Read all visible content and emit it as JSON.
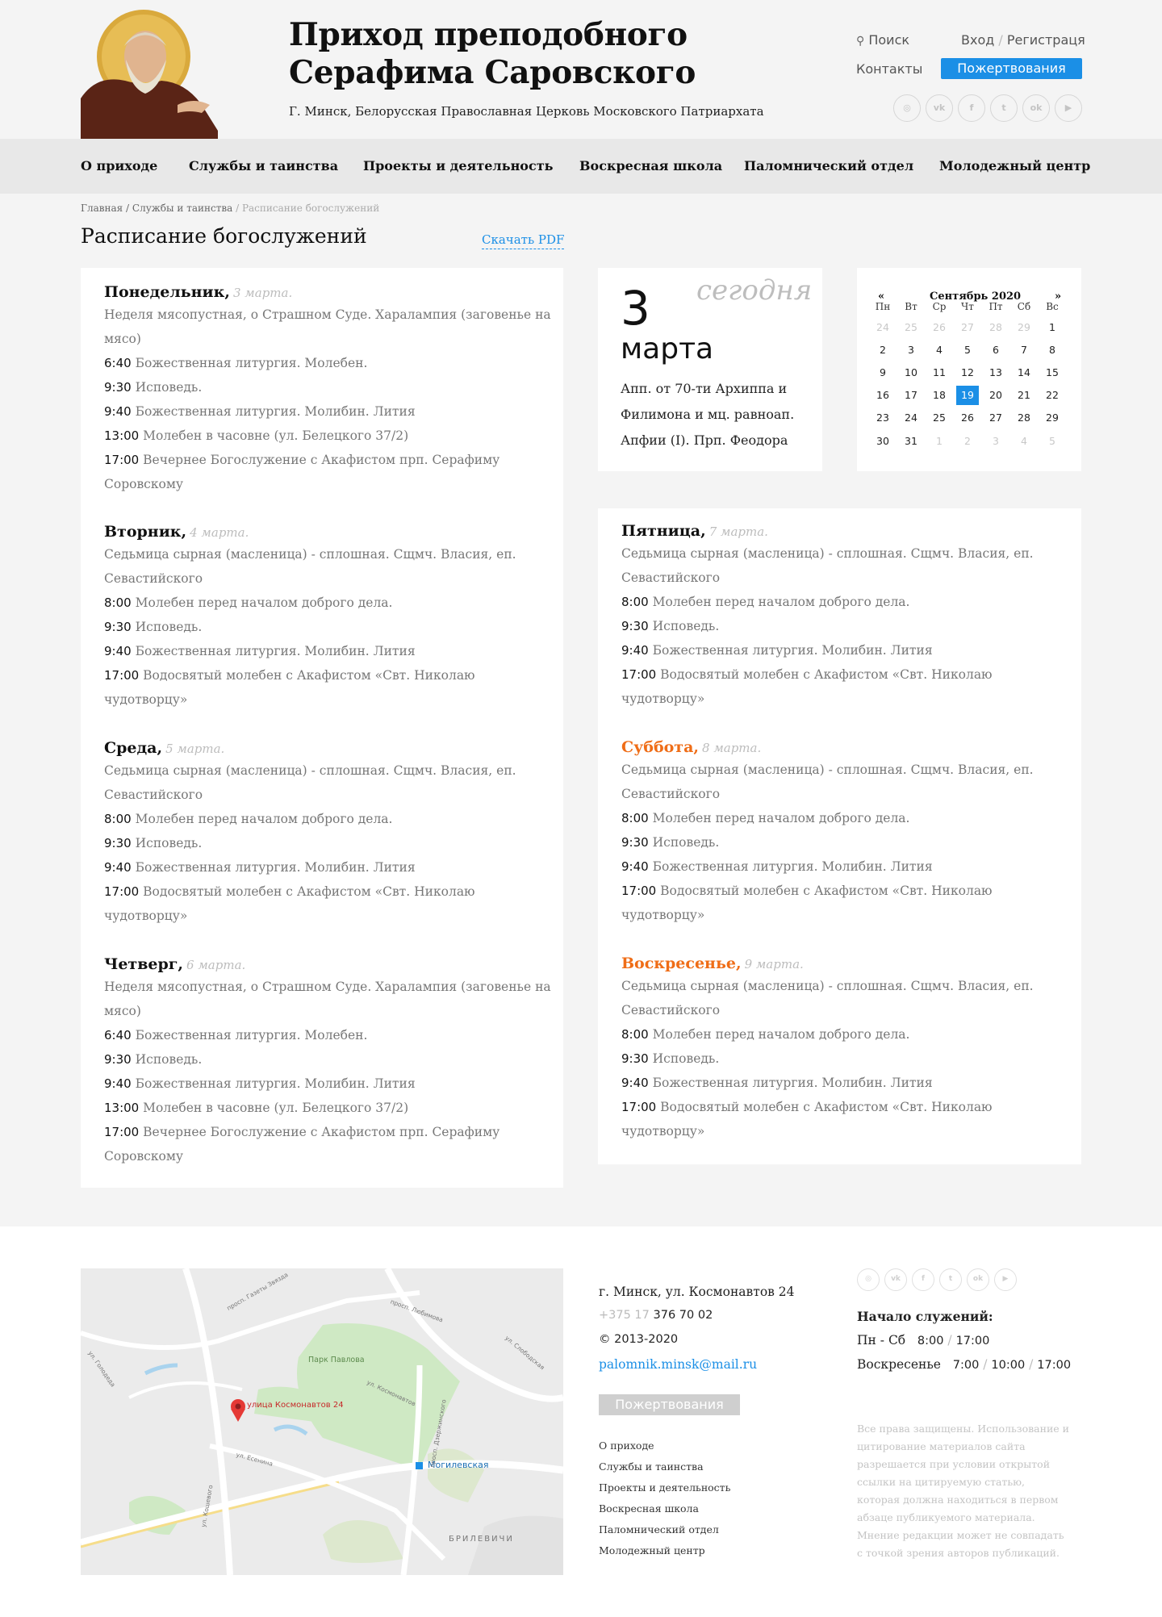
{
  "header": {
    "title_line1": "Приход преподобного",
    "title_line2": "Серафима Саровского",
    "subtitle": "Г. Минск, Белорусская Православная Церковь Московского Патриархата",
    "search": "Поиск",
    "login": "Вход",
    "register": "Регистраця",
    "contacts": "Контакты",
    "donate": "Пожертвования",
    "social": [
      "instagram-icon",
      "vk-icon",
      "facebook-icon",
      "twitter-icon",
      "odnoklassniki-icon",
      "youtube-icon"
    ]
  },
  "nav": [
    "О приходе",
    "Службы и таинства",
    "Проекты и деятельность",
    "Воскресная школа",
    "Паломнический отдел",
    "Молодежный центр"
  ],
  "breadcrumb": {
    "home": "Главная",
    "section": "Службы и таинства",
    "current": "Расписание богослужений"
  },
  "page": {
    "title": "Расписание богослужений",
    "pdf": "Скачать PDF"
  },
  "today": {
    "label": "сегодня",
    "day": "3",
    "month": "марта",
    "text": "Апп. от 70-ти Архиппа и Филимона и мц. равноап. Апфии (I). Прп. Феодора"
  },
  "calendar": {
    "prev": "«",
    "next": "»",
    "title": "Сентябрь 2020",
    "weekdays": [
      "Пн",
      "Вт",
      "Ср",
      "Чт",
      "Пт",
      "Сб",
      "Вс"
    ],
    "weeks": [
      [
        "24",
        "25",
        "26",
        "27",
        "28",
        "29",
        "1"
      ],
      [
        "2",
        "3",
        "4",
        "5",
        "6",
        "7",
        "8"
      ],
      [
        "9",
        "10",
        "11",
        "12",
        "13",
        "14",
        "15"
      ],
      [
        "16",
        "17",
        "18",
        "19",
        "20",
        "21",
        "22"
      ],
      [
        "23",
        "24",
        "25",
        "26",
        "27",
        "28",
        "29"
      ],
      [
        "30",
        "31",
        "1",
        "2",
        "3",
        "4",
        "5"
      ]
    ],
    "selected": "19"
  },
  "days_left": [
    {
      "name": "Понедельник,",
      "date": "3 марта.",
      "desc": "Неделя мясопустная, о Страшном Суде. Харалампия (заговенье на мясо)",
      "items": [
        [
          "6:40",
          "Божественная литургия. Молебен."
        ],
        [
          "9:30",
          "Исповедь."
        ],
        [
          "9:40",
          "Божественная литургия. Молибин. Лития"
        ],
        [
          "13:00",
          "Молебен в часовне (ул. Белецкого 37/2)"
        ],
        [
          "17:00",
          "Вечернее Богослужение с Акафистом прп. Серафиму Соровскому"
        ]
      ]
    },
    {
      "name": "Вторник,",
      "date": "4 марта.",
      "desc": "Седьмица сырная (масленица)  - сплошная. Сщмч. Власия, еп. Севастийского",
      "items": [
        [
          "8:00",
          "Молебен перед началом доброго дела."
        ],
        [
          "9:30",
          "Исповедь."
        ],
        [
          "9:40",
          "Божественная литургия. Молибин. Лития"
        ],
        [
          "17:00",
          "Водосвятый молебен с Акафистом «Свт. Николаю чудотворцу»"
        ]
      ]
    },
    {
      "name": "Среда,",
      "date": "5 марта.",
      "desc": "Седьмица сырная (масленица)  - сплошная. Сщмч. Власия, еп. Севастийского",
      "items": [
        [
          "8:00",
          "Молебен перед началом доброго дела."
        ],
        [
          "9:30",
          "Исповедь."
        ],
        [
          "9:40",
          "Божественная литургия. Молибин. Лития"
        ],
        [
          "17:00",
          "Водосвятый молебен с Акафистом «Свт. Николаю чудотворцу»"
        ]
      ]
    },
    {
      "name": "Четверг,",
      "date": "6 марта.",
      "desc": "Неделя мясопустная, о Страшном Суде. Харалампия (заговенье на мясо)",
      "items": [
        [
          "6:40",
          "Божественная литургия. Молебен."
        ],
        [
          "9:30",
          "Исповедь."
        ],
        [
          "9:40",
          "Божественная литургия. Молибин. Лития"
        ],
        [
          "13:00",
          "Молебен в часовне (ул. Белецкого 37/2)"
        ],
        [
          "17:00",
          "Вечернее Богослужение с Акафистом прп. Серафиму Соровскому"
        ]
      ]
    }
  ],
  "days_right": [
    {
      "name": "Пятница,",
      "date": "7 марта.",
      "desc": "Седьмица сырная (масленица)  - сплошная. Сщмч. Власия, еп. Севастийского",
      "items": [
        [
          "8:00",
          "Молебен перед началом доброго дела."
        ],
        [
          "9:30",
          "Исповедь."
        ],
        [
          "9:40",
          "Божественная литургия. Молибин. Лития"
        ],
        [
          "17:00",
          "Водосвятый молебен с Акафистом «Свт. Николаю чудотворцу»"
        ]
      ]
    },
    {
      "name": "Суббота,",
      "date": "8 марта.",
      "desc": "Седьмица сырная (масленица)  - сплошная. Сщмч. Власия, еп. Севастийского",
      "items": [
        [
          "8:00",
          "Молебен перед началом доброго дела."
        ],
        [
          "9:30",
          "Исповедь."
        ],
        [
          "9:40",
          "Божественная литургия. Молибин. Лития"
        ],
        [
          "17:00",
          "Водосвятый молебен с Акафистом «Свт. Николаю чудотворцу»"
        ]
      ]
    },
    {
      "name": "Воскресенье,",
      "date": "9 марта.",
      "desc": "Седьмица сырная (масленица)  - сплошная. Сщмч. Власия, еп. Севастийского",
      "items": [
        [
          "8:00",
          "Молебен перед началом доброго дела."
        ],
        [
          "9:30",
          "Исповедь."
        ],
        [
          "9:40",
          "Божественная литургия. Молибин. Лития"
        ],
        [
          "17:00",
          "Водосвятый молебен с Акафистом «Свт. Николаю чудотворцу»"
        ]
      ]
    }
  ],
  "footer": {
    "address": "г. Минск, ул. Космонавтов 24",
    "phone_prefix": "+375 17",
    "phone": "376 70 02",
    "copyright": "©  2013-2020",
    "email": "palomnik.minsk@mail.ru",
    "donate": "Пожертвования",
    "links": [
      "О приходе",
      "Службы и таинства",
      "Проекты и деятельность",
      "Воскресная школа",
      "Паломнический отдел",
      "Молодежный центр"
    ],
    "services_title": "Начало служений:",
    "weekdays_label": "Пн - Сб",
    "weekdays_times": [
      "8:00",
      "17:00"
    ],
    "sunday_label": "Воскресенье",
    "sunday_times": [
      "7:00",
      "10:00",
      "17:00"
    ],
    "note": "Все права защищены. Использование и цитирование материалов сайта разрешается при условии открытой ссылки на цитируемую статью, которая должна находиться в первом абзаце публикуемого материала. Мнение редакции может не совпадать с точкой зрения авторов публикаций."
  },
  "map": {
    "labels": [
      "улица Космонавтов 24",
      "Парк Павлова",
      "Могилевская",
      "БРИЛЕВИЧИ",
      "просп. Любимова",
      "ул. Космонавтов",
      "ул. Есенина",
      "ул. Голодеда",
      "просп. Газеты Звязда",
      "просп. Дзержинского",
      "ул. Кошевого",
      "ул. Слободская"
    ]
  },
  "colors": {
    "accent": "#1b8fe6",
    "weekend": "#ef6d17",
    "muted": "#bdbdbd"
  }
}
